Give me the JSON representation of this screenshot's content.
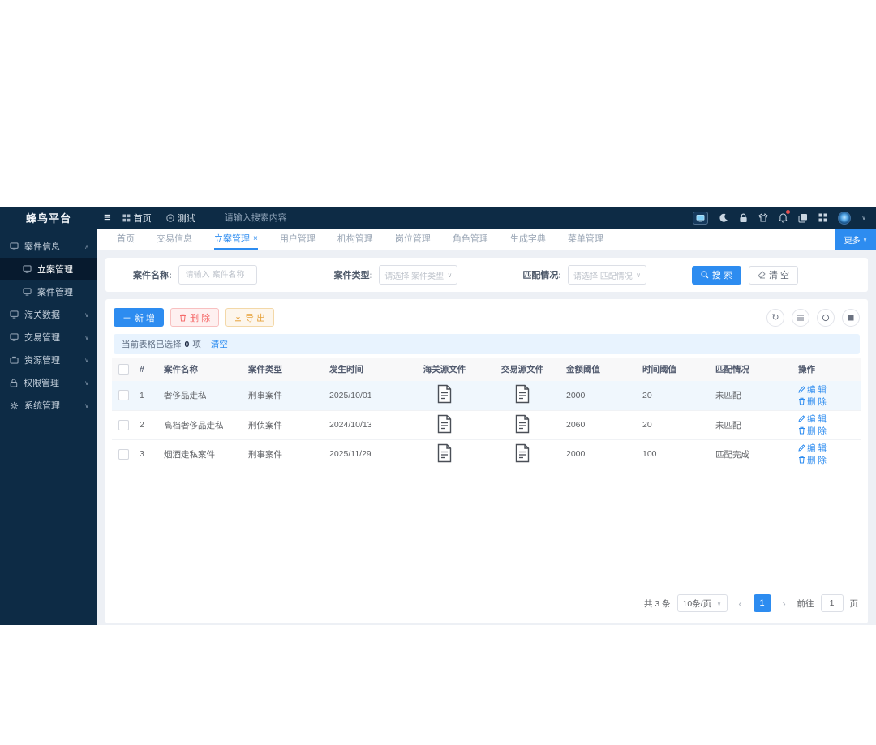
{
  "app": {
    "logo": "蜂鸟平台"
  },
  "colors": {
    "accent": "#2d8cf0",
    "danger": "#f56c6c",
    "warning": "#e6a23c",
    "dark": "#0d2b45"
  },
  "topbar": {
    "nav": [
      {
        "label": "首页"
      },
      {
        "label": "测试"
      }
    ],
    "search_placeholder": "请输入搜索内容"
  },
  "sidebar": {
    "items": [
      {
        "label": "案件信息",
        "expanded": true
      },
      {
        "label": "立案管理",
        "active": true
      },
      {
        "label": "案件管理"
      },
      {
        "label": "海关数据"
      },
      {
        "label": "交易管理"
      },
      {
        "label": "资源管理"
      },
      {
        "label": "权限管理"
      },
      {
        "label": "系统管理"
      }
    ]
  },
  "tabs": {
    "items": [
      {
        "label": "首页"
      },
      {
        "label": "交易信息"
      },
      {
        "label": "立案管理",
        "active": true,
        "close": "×"
      },
      {
        "label": "用户管理"
      },
      {
        "label": "机构管理"
      },
      {
        "label": "岗位管理"
      },
      {
        "label": "角色管理"
      },
      {
        "label": "生成字典"
      },
      {
        "label": "菜单管理"
      }
    ],
    "more_label": "更多"
  },
  "filter": {
    "name_label": "案件名称:",
    "name_placeholder": "请输入 案件名称",
    "type_label": "案件类型:",
    "type_placeholder": "请选择 案件类型",
    "match_label": "匹配情况:",
    "match_placeholder": "请选择 匹配情况",
    "search_label": "搜 索",
    "clear_label": "清 空"
  },
  "toolbar": {
    "add_label": "新 增",
    "delete_label": "删 除",
    "export_label": "导 出"
  },
  "selection_bar": {
    "prefix": "当前表格已选择",
    "count": "0",
    "suffix": "项",
    "clear_label": "清空"
  },
  "table": {
    "columns": [
      "#",
      "案件名称",
      "案件类型",
      "发生时间",
      "海关源文件",
      "交易源文件",
      "金额阈值",
      "时间阈值",
      "匹配情况",
      "操作"
    ],
    "edit_label": "编 辑",
    "delete_label": "删 除",
    "rows": [
      {
        "index": "1",
        "name": "奢侈品走私",
        "type": "刑事案件",
        "date": "2025/10/01",
        "amount": "2000",
        "time": "20",
        "match": "未匹配"
      },
      {
        "index": "2",
        "name": "高档奢侈品走私",
        "type": "刑侦案件",
        "date": "2024/10/13",
        "amount": "2060",
        "time": "20",
        "match": "未匹配"
      },
      {
        "index": "3",
        "name": "烟酒走私案件",
        "type": "刑事案件",
        "date": "2025/11/29",
        "amount": "2000",
        "time": "100",
        "match": "匹配完成"
      }
    ]
  },
  "pagination": {
    "total": "共 3 条",
    "page_size": "10条/页",
    "prev": "‹",
    "current": "1",
    "next": "›",
    "goto_prefix": "前往",
    "goto_value": "1",
    "goto_suffix": "页"
  }
}
